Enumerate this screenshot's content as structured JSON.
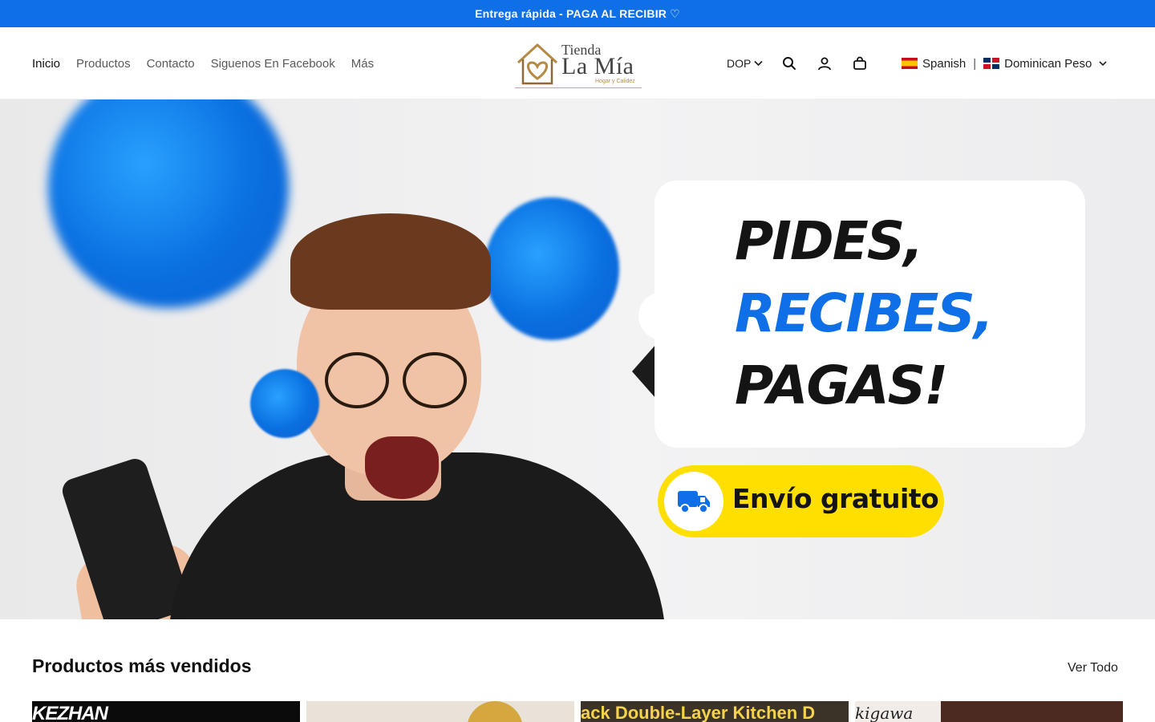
{
  "announcement": {
    "text": "Entrega rápida - PAGA AL RECIBIR",
    "icon": "white-heart-icon"
  },
  "nav": {
    "items": [
      {
        "label": "Inicio",
        "active": true
      },
      {
        "label": "Productos"
      },
      {
        "label": "Contacto"
      },
      {
        "label": "Siguenos En Facebook"
      },
      {
        "label": "Más"
      }
    ]
  },
  "logo": {
    "line1": "Tienda",
    "line2": "La Mía",
    "tagline": "Hogar y Calidez"
  },
  "utilities": {
    "currency": "DOP",
    "icons": [
      "search-icon",
      "account-icon",
      "cart-icon"
    ]
  },
  "language": {
    "language_label": "Spanish",
    "separator": "|",
    "currency_label": "Dominican Peso"
  },
  "hero": {
    "headline": [
      "PIDES,",
      "RECIBES,",
      "PAGAS!"
    ],
    "shipping_badge": "Envío gratuito",
    "colors": {
      "accent": "#0f6fe6",
      "badge": "#ffdf00"
    }
  },
  "best_sellers": {
    "title": "Productos más vendidos",
    "view_all": "Ver Todo",
    "products": [
      {
        "visible_text": "KEZHAN"
      },
      {
        "visible_text": ""
      },
      {
        "visible_text": "ack Double-Layer Kitchen D"
      },
      {
        "visible_text": "kigawa"
      }
    ]
  },
  "colors": {
    "primary": "#0f6fe6",
    "text": "#222222",
    "logo_gold": "#b48a44"
  }
}
